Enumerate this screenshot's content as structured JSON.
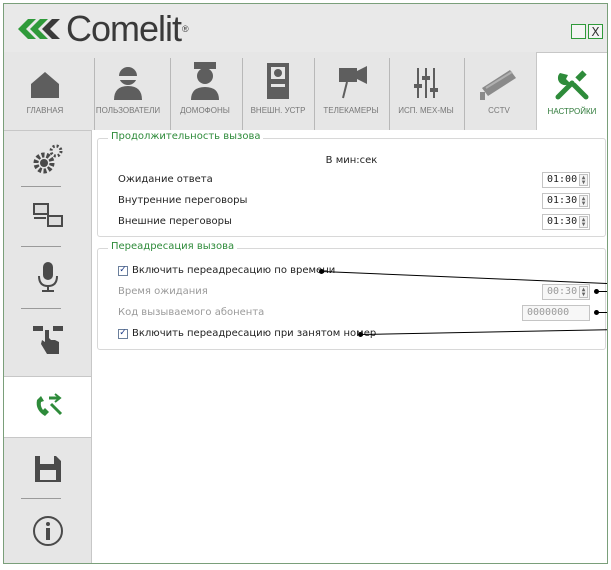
{
  "app": {
    "brand": "Comelit",
    "brand_mark": "®"
  },
  "window": {
    "minimize": "_",
    "close": "X"
  },
  "colors": {
    "accent": "#2e8b3a",
    "frame": "#7a9f7a"
  },
  "tabs": [
    {
      "label": "ГЛАВНАЯ",
      "icon": "home-icon"
    },
    {
      "label": "ПОЛЬЗОВАТЕЛИ",
      "icon": "user-icon"
    },
    {
      "label": "ДОМОФОНЫ",
      "icon": "doorman-icon"
    },
    {
      "label": "ВНЕШН. УСТР",
      "icon": "entrance-panel-icon"
    },
    {
      "label": "ТЕЛЕКАМЕРЫ",
      "icon": "camera-icon"
    },
    {
      "label": "ИСП. МЕХ-МЫ",
      "icon": "actuator-icon"
    },
    {
      "label": "CCTV",
      "icon": "cctv-icon"
    },
    {
      "label": "НАСТРОЙКИ",
      "icon": "settings-tools-icon",
      "active": true
    }
  ],
  "sidebar": [
    {
      "icon": "gears-icon"
    },
    {
      "icon": "network-icon"
    },
    {
      "icon": "microphone-icon"
    },
    {
      "icon": "hand-touch-icon"
    },
    {
      "icon": "call-forward-icon",
      "active": true
    },
    {
      "icon": "save-icon"
    },
    {
      "icon": "info-icon"
    }
  ],
  "call_duration": {
    "title": "Продолжительность вызова",
    "units": "В мин:сек",
    "rows": [
      {
        "label": "Ожидание ответа",
        "value": "01:00"
      },
      {
        "label": "Внутренние переговоры",
        "value": "01:30"
      },
      {
        "label": "Внешние переговоры",
        "value": "01:30"
      }
    ]
  },
  "call_forward": {
    "title": "Переадресация вызова",
    "timed_forward": {
      "label": "Включить переадресацию по времени",
      "checked": true
    },
    "wait_time": {
      "label": "Время ожидания",
      "value": "00:30"
    },
    "called_code": {
      "label": "Код вызываемого абонента",
      "value": "0000000"
    },
    "busy_forward": {
      "label": "Включить переадресацию при занятом номер",
      "checked": true
    }
  }
}
